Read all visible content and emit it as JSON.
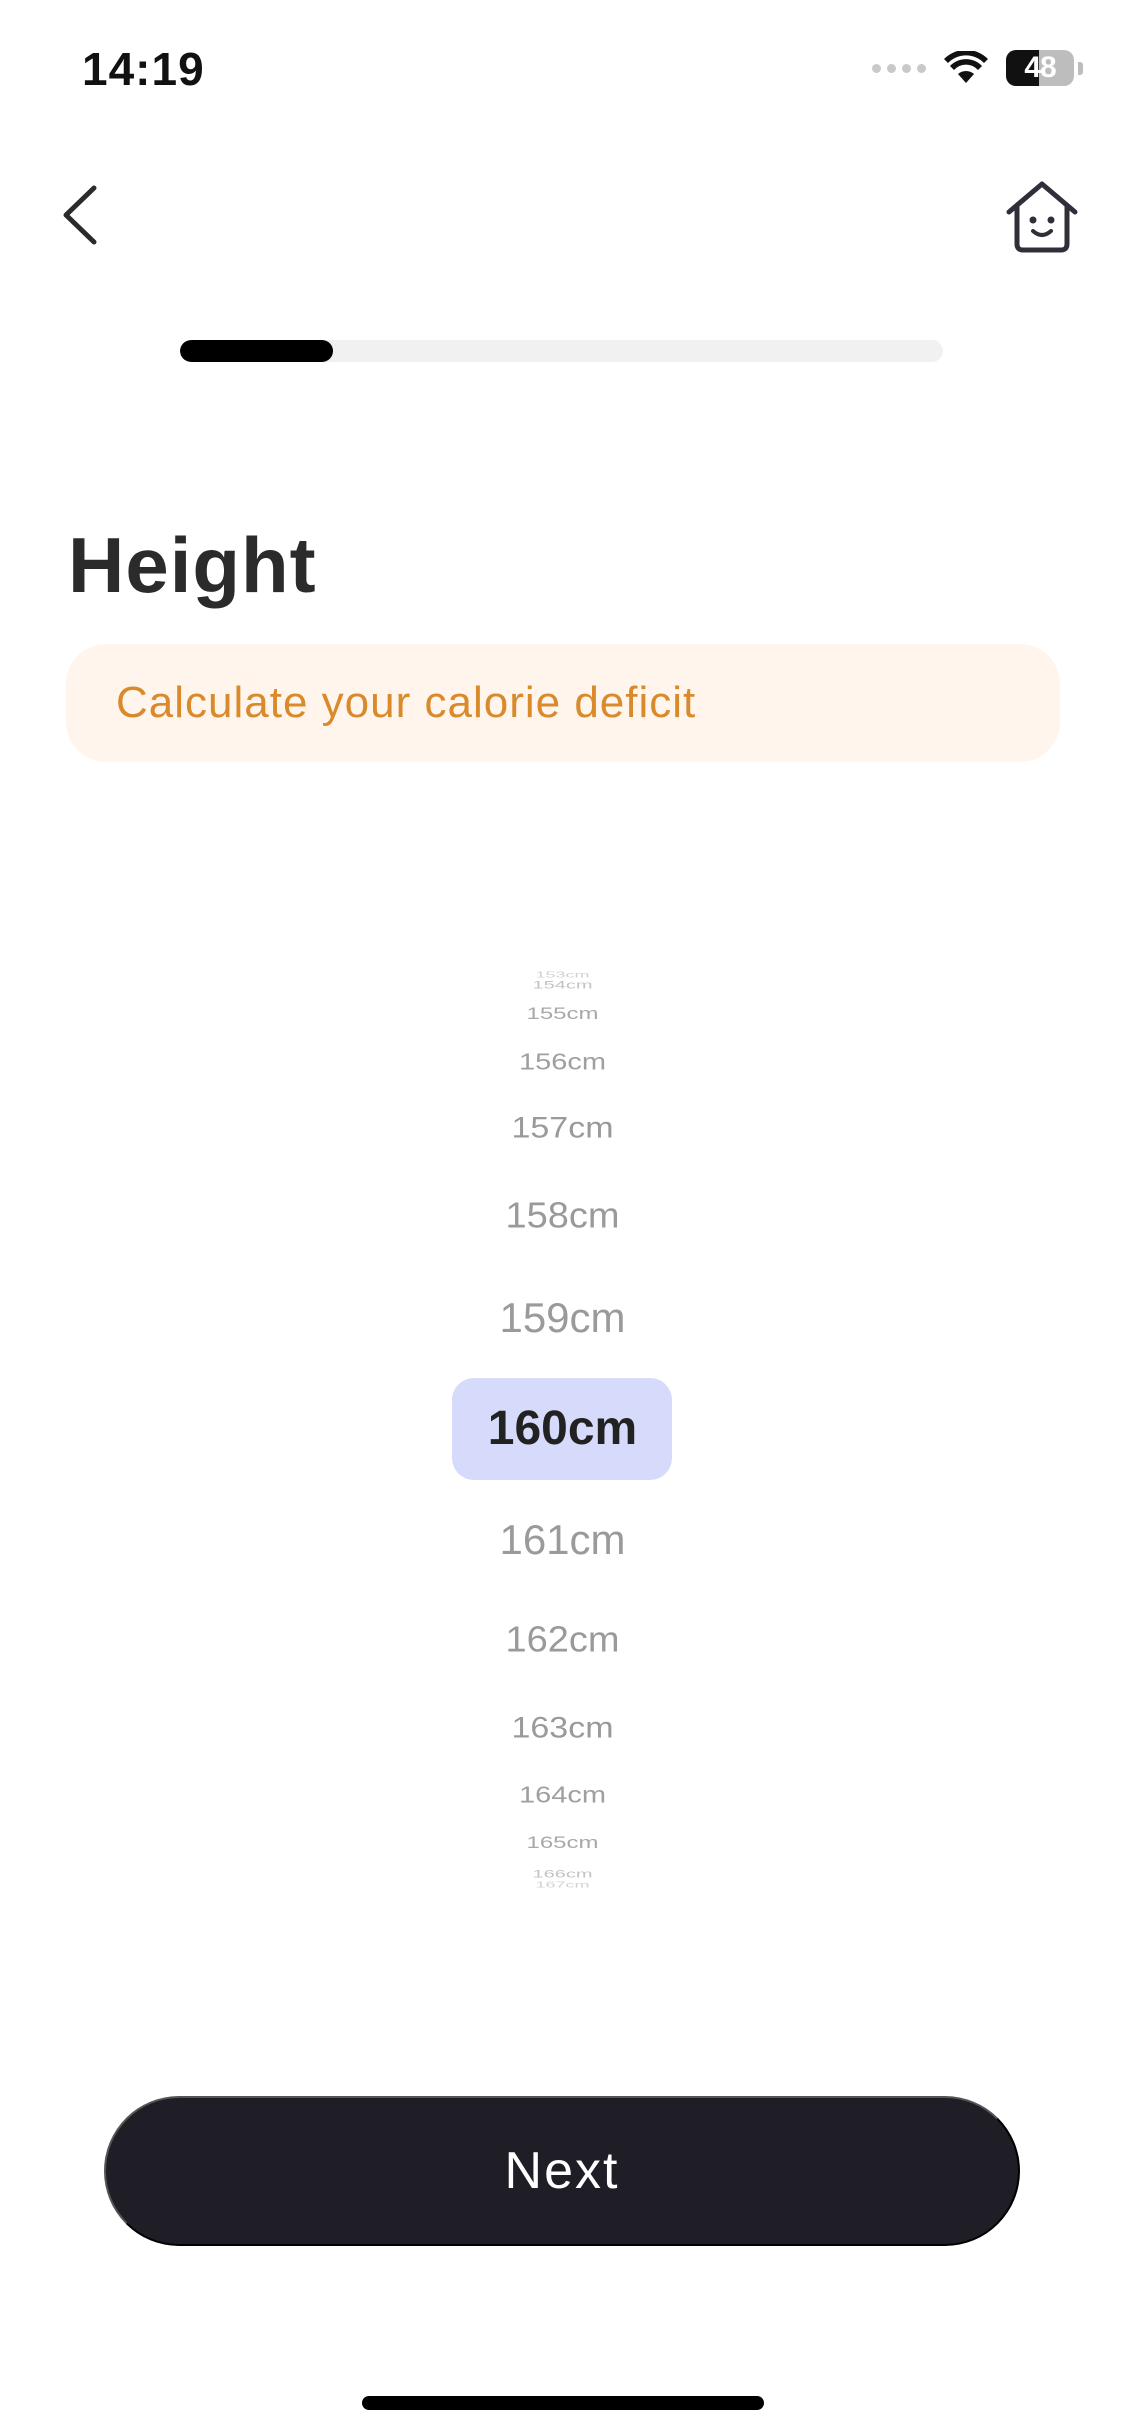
{
  "status_bar": {
    "time": "14:19",
    "battery_level": "48",
    "icons": [
      "signal-dots-icon",
      "wifi-icon",
      "battery-icon"
    ]
  },
  "nav": {
    "back_icon": "chevron-left-icon",
    "home_icon": "smiling-house-icon"
  },
  "progress": {
    "fraction": 0.2
  },
  "page": {
    "title": "Height",
    "subtitle": "Calculate your calorie deficit"
  },
  "picker": {
    "items": [
      "153cm",
      "154cm",
      "155cm",
      "156cm",
      "157cm",
      "158cm",
      "159cm",
      "160cm",
      "161cm",
      "162cm",
      "163cm",
      "164cm",
      "165cm",
      "166cm",
      "167cm"
    ],
    "selected": "160cm",
    "selected_color": "#d6dbfc"
  },
  "actions": {
    "next_label": "Next"
  },
  "colors": {
    "accent_text": "#d98a2b",
    "accent_bg": "#fff5ec",
    "button_bg": "#1f1d26",
    "progress_fill": "#000000",
    "progress_track": "#f1f1f1"
  }
}
